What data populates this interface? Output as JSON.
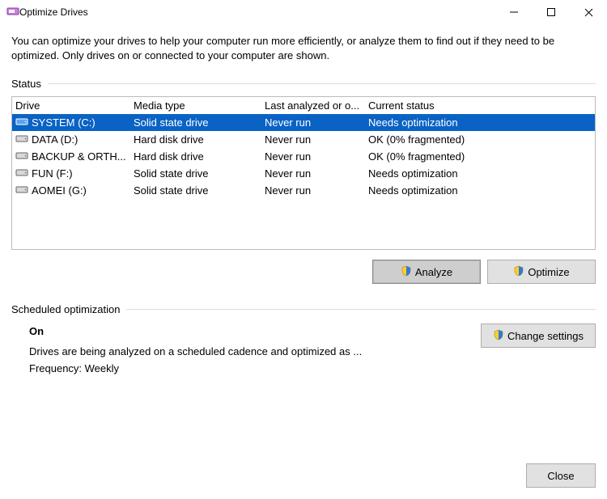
{
  "window": {
    "title": "Optimize Drives"
  },
  "description": "You can optimize your drives to help your computer run more efficiently, or analyze them to find out if they need to be optimized. Only drives on or connected to your computer are shown.",
  "status_label": "Status",
  "columns": {
    "drive": "Drive",
    "media": "Media type",
    "last": "Last analyzed or o...",
    "status": "Current status"
  },
  "drives": [
    {
      "name": "SYSTEM (C:)",
      "media": "Solid state drive",
      "last": "Never run",
      "status": "Needs optimization",
      "selected": true
    },
    {
      "name": "DATA (D:)",
      "media": "Hard disk drive",
      "last": "Never run",
      "status": "OK (0% fragmented)",
      "selected": false
    },
    {
      "name": "BACKUP & ORTH...",
      "media": "Hard disk drive",
      "last": "Never run",
      "status": "OK (0% fragmented)",
      "selected": false
    },
    {
      "name": "FUN (F:)",
      "media": "Solid state drive",
      "last": "Never run",
      "status": "Needs optimization",
      "selected": false
    },
    {
      "name": "AOMEI (G:)",
      "media": "Solid state drive",
      "last": "Never run",
      "status": "Needs optimization",
      "selected": false
    }
  ],
  "buttons": {
    "analyze": "Analyze",
    "optimize": "Optimize",
    "change_settings": "Change settings",
    "close": "Close"
  },
  "schedule": {
    "label": "Scheduled optimization",
    "state": "On",
    "desc": "Drives are being analyzed on a scheduled cadence and optimized as ...",
    "freq": "Frequency: Weekly"
  }
}
